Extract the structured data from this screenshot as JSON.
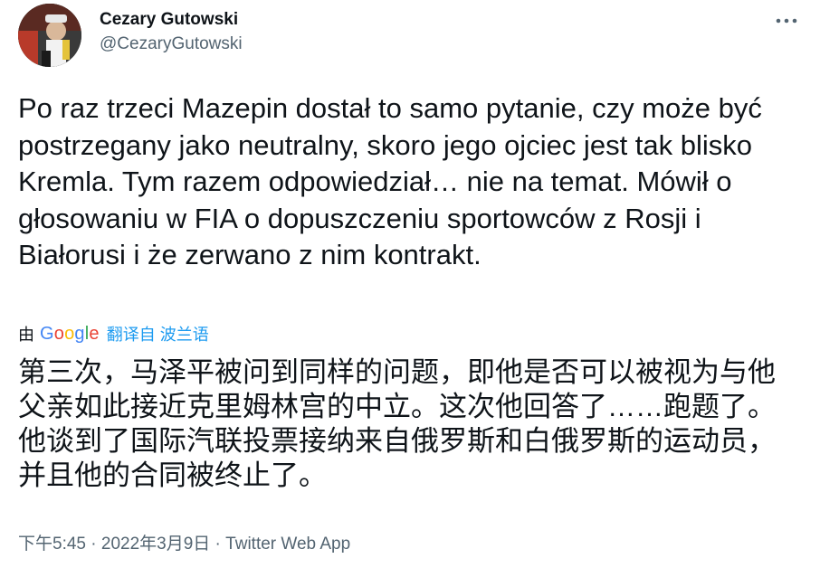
{
  "author": {
    "display_name": "Cezary Gutowski",
    "handle": "@CezaryGutowski"
  },
  "icons": {
    "more": "more-horizontal-icon",
    "avatar": "profile-photo"
  },
  "tweet": {
    "text": "Po raz trzeci Mazepin dostał to samo pytanie, czy może być postrzegany jako neutralny, skoro jego ojciec jest tak blisko Kremla. Tym razem odpowiedział… nie na temat. Mówił o głosowaniu w FIA o dopuszczeniu sportowców z Rosji i Białorusi i że zerwano z nim kontrakt."
  },
  "translation": {
    "by_label": "由",
    "provider": "Google",
    "link_label": "翻译自 波兰语",
    "text": "第三次，马泽平被问到同样的问题，即他是否可以被视为与他父亲如此接近克里姆林宫的中立。这次他回答了……跑题了。他谈到了国际汽联投票接纳来自俄罗斯和白俄罗斯的运动员，并且他的合同被终止了。"
  },
  "meta": {
    "time": "下午5:45",
    "separator": " · ",
    "date": "2022年3月9日",
    "source": "Twitter Web App"
  },
  "colors": {
    "text": "#0f1419",
    "secondary": "#536471",
    "link": "#1d9bf0"
  }
}
